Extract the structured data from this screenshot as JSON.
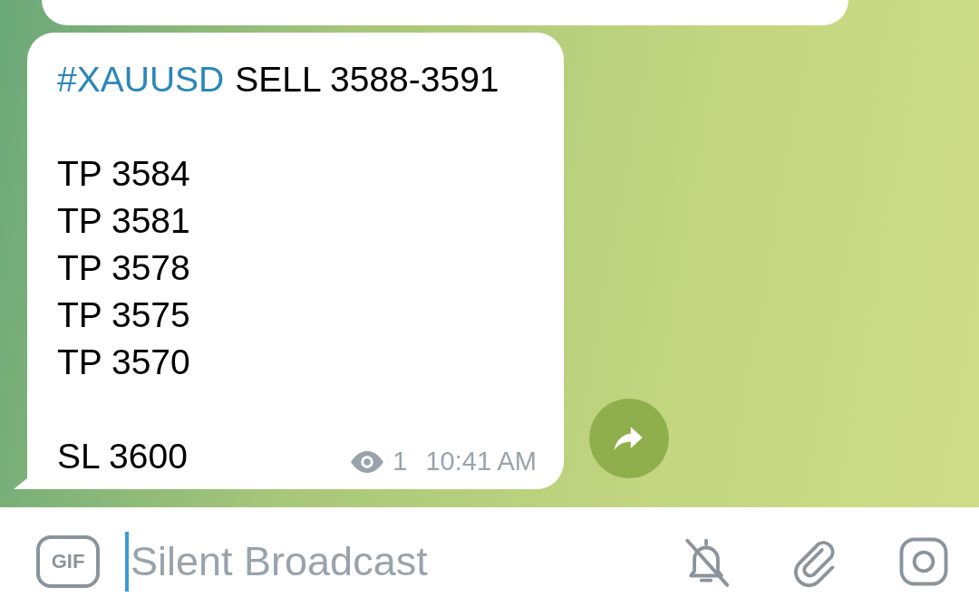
{
  "message": {
    "hashtag": "#XAUUSD",
    "title": "SELL 3588-3591",
    "blocks": [
      {
        "lines": [
          "TP 3584",
          "TP 3581",
          "TP 3578",
          "TP 3575",
          "TP 3570"
        ]
      },
      {
        "lines": [
          "SL 3600"
        ]
      }
    ],
    "views": "1",
    "time": "10:41 AM"
  },
  "composer": {
    "gif_label": "GIF",
    "placeholder": "Silent Broadcast",
    "notifications_muted": true
  }
}
